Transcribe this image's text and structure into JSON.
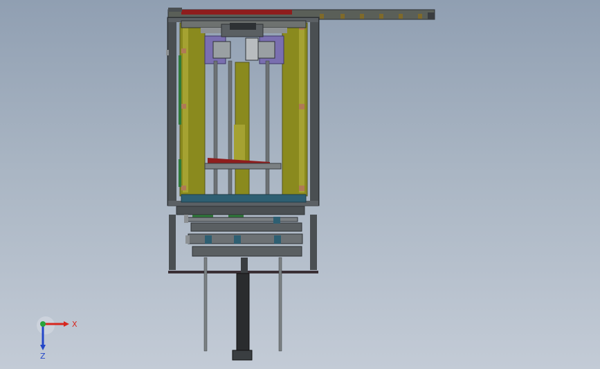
{
  "viewport": {
    "background_top": "#909fb2",
    "background_bottom": "#c3cbd6"
  },
  "model": {
    "colors": {
      "frame": "#4a4f52",
      "frame_dark": "#2d3134",
      "panel_olive": "#8a8a1e",
      "panel_olive_light": "#a5a232",
      "accent_red": "#8e1d1d",
      "plate_teal": "#2e5f72",
      "block_purple": "#7a6fb0",
      "green_part": "#2f7a3a",
      "rod": "#6d7275",
      "cylinder": "#2a2c2e"
    }
  },
  "triad": {
    "x_label": "X",
    "z_label": "Z",
    "x_color": "#d7261e",
    "y_color": "#2aa33a",
    "z_color": "#2346c8"
  }
}
